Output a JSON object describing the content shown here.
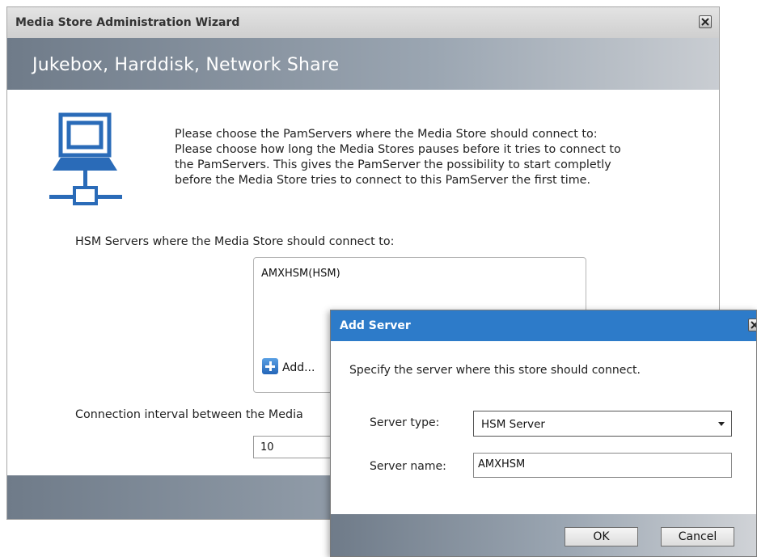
{
  "wizard": {
    "title": "Media Store Administration Wizard",
    "header": "Jukebox, Harddisk, Network Share",
    "description_lines": [
      "Please choose the PamServers where the Media Store should connect to:",
      "Please choose how long the Media Stores pauses before it tries to connect to",
      "the PamServers. This gives the PamServer the possibility to start completly",
      "before the Media Store tries to connect to this PamServer the first time."
    ],
    "hsm_label": "HSM Servers where the Media Store should connect to:",
    "servers": [
      "AMXHSM(HSM)"
    ],
    "add_label": "Add...",
    "interval_label": "Connection interval between the Media",
    "interval_value": "10"
  },
  "dialog": {
    "title": "Add Server",
    "prompt": "Specify the server where this store should connect.",
    "server_type_label": "Server type:",
    "server_type_value": "HSM Server",
    "server_name_label": "Server name:",
    "server_name_value": "AMXHSM",
    "ok_label": "OK",
    "cancel_label": "Cancel"
  },
  "colors": {
    "dialog_titlebar": "#2d7bc9",
    "icon_blue": "#2a6bb8",
    "band_gray": "#8f9aa6"
  },
  "icons": [
    "close-icon",
    "network-computer-icon",
    "add-plus-icon",
    "dropdown-arrow-icon"
  ]
}
